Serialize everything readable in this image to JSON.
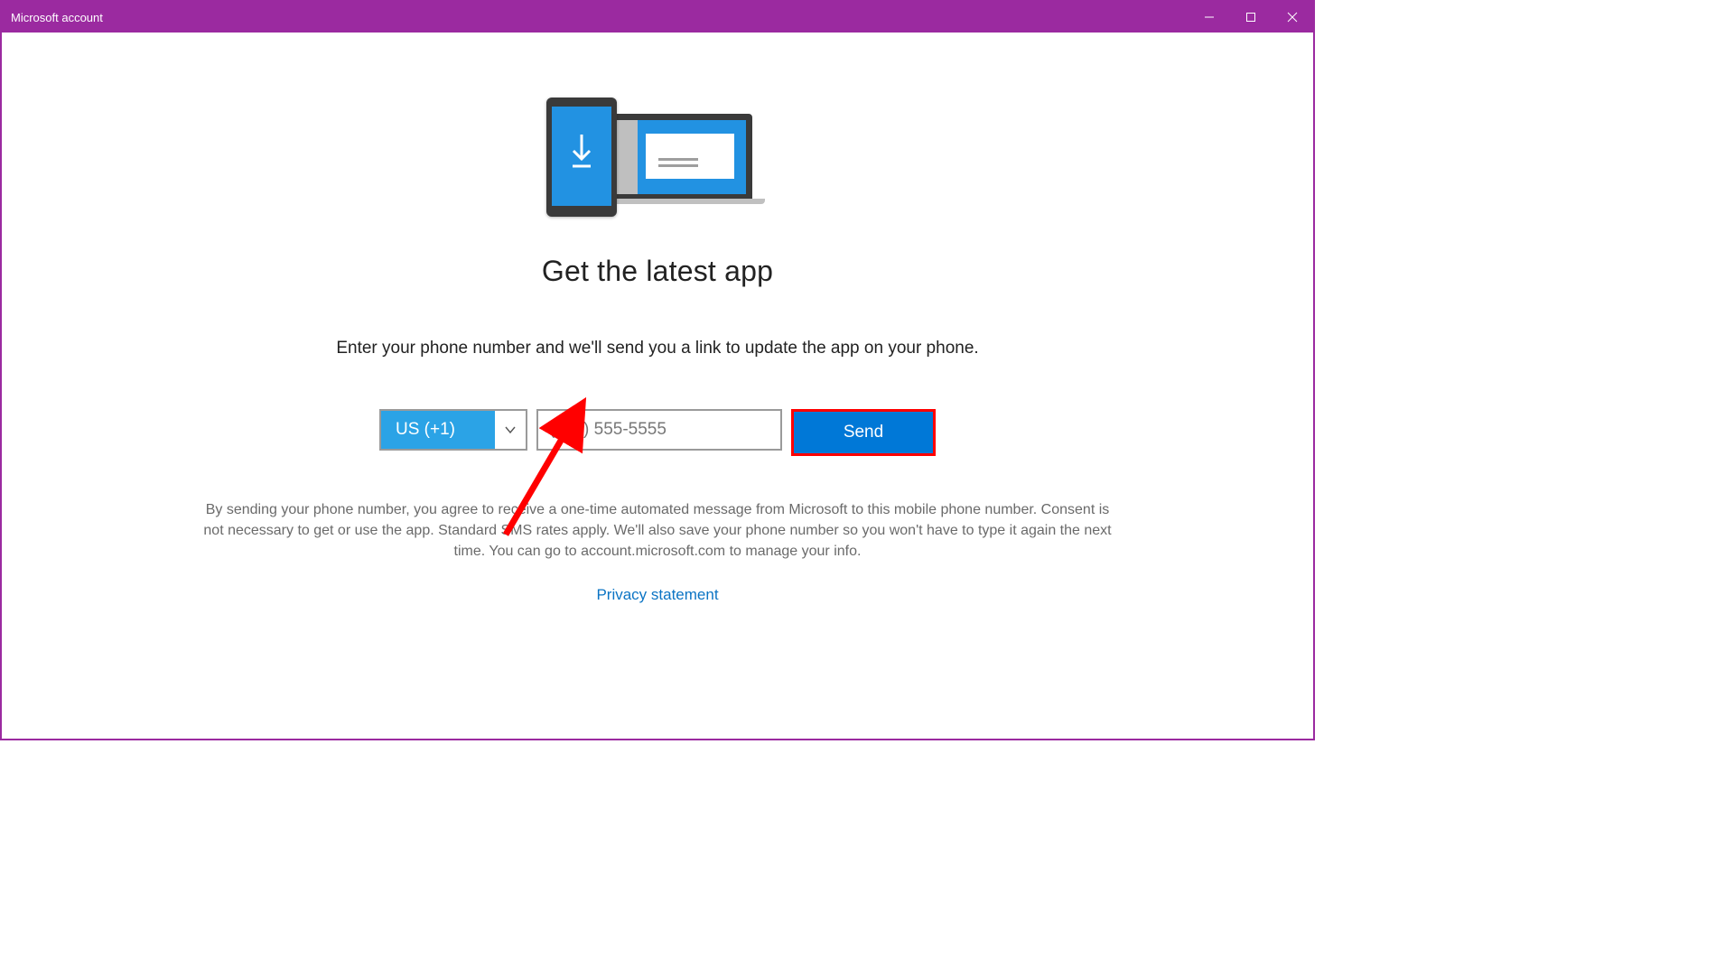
{
  "window": {
    "title": "Microsoft account"
  },
  "page": {
    "title": "Get the latest app",
    "subtitle": "Enter your phone number and we'll send you a link to update the app on your phone."
  },
  "form": {
    "country_code": "US (+1)",
    "phone_placeholder": "(555) 555-5555",
    "phone_value": "",
    "send_label": "Send"
  },
  "disclaimer": "By sending your phone number, you agree to receive a one-time automated message from Microsoft to this mobile phone number.  Consent is not necessary to get or use the app.  Standard SMS rates apply. We'll also save your phone number so you won't have to type it again the next time. You can go to account.microsoft.com to manage your info.",
  "privacy_link": "Privacy statement",
  "colors": {
    "accent_purple": "#9b2aa0",
    "accent_blue": "#0078d7",
    "light_blue": "#2ba3e6",
    "annotation_red": "#ff0000"
  }
}
